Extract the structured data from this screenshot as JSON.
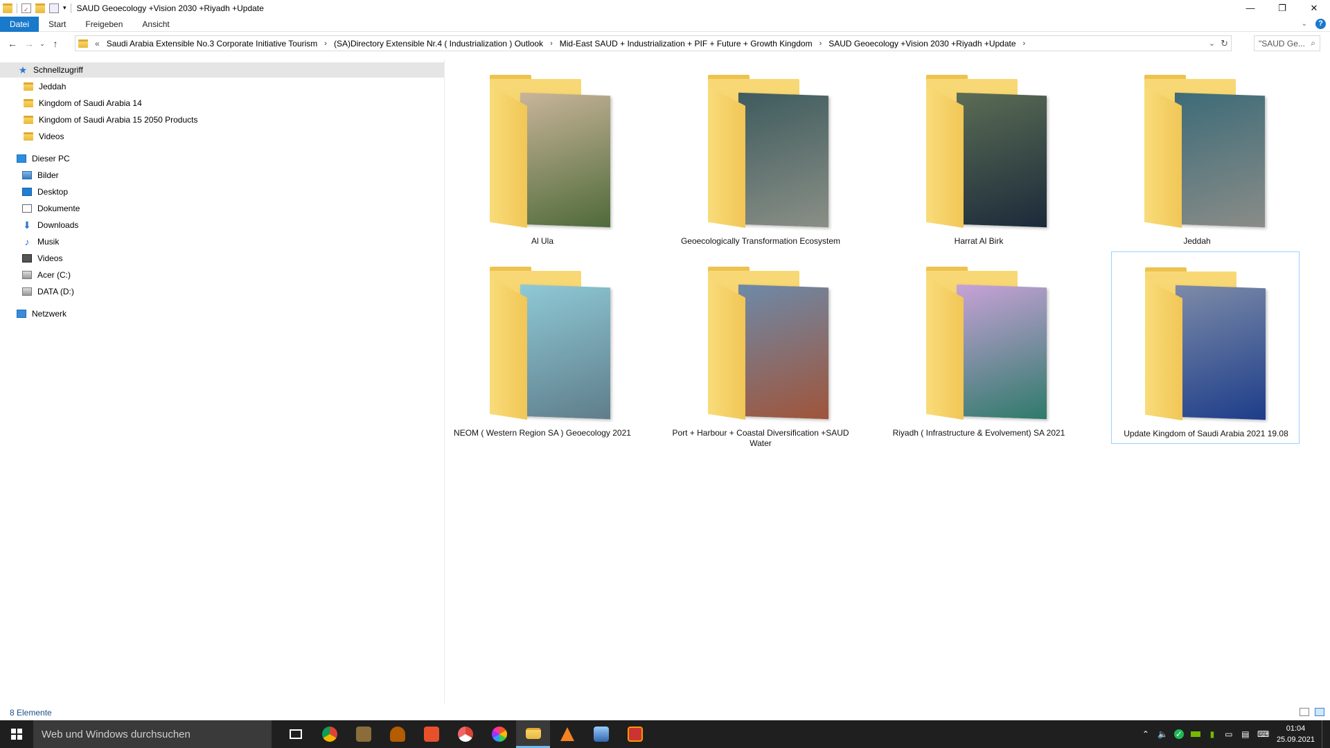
{
  "window": {
    "title": "SAUD Geoecology +Vision 2030 +Riyadh +Update",
    "min_glyph": "—",
    "max_glyph": "❐",
    "close_glyph": "✕"
  },
  "ribbon": {
    "tabs": [
      {
        "label": "Datei"
      },
      {
        "label": "Start"
      },
      {
        "label": "Freigeben"
      },
      {
        "label": "Ansicht"
      }
    ],
    "help": "?"
  },
  "address": {
    "overflow": "«",
    "crumbs": [
      "Saudi Arabia Extensible No.3 Corporate Initiative Tourism",
      "(SA)Directory Extensible Nr.4 ( Industrialization ) Outlook",
      "Mid-East SAUD + Industrialization + PIF + Future + Growth Kingdom",
      "SAUD Geoecology +Vision 2030 +Riyadh +Update"
    ],
    "separator": "›",
    "search_placeholder": "\"SAUD Ge..."
  },
  "navpane": {
    "quick_access": "Schnellzugriff",
    "quick_items": [
      {
        "label": "Jeddah"
      },
      {
        "label": "Kingdom of Saudi Arabia 14"
      },
      {
        "label": "Kingdom of Saudi Arabia 15 2050 Products"
      },
      {
        "label": "Videos"
      }
    ],
    "this_pc": "Dieser PC",
    "pc_items": [
      {
        "label": "Bilder",
        "icon": "pictures-icon"
      },
      {
        "label": "Desktop",
        "icon": "desktop-icon"
      },
      {
        "label": "Dokumente",
        "icon": "documents-icon"
      },
      {
        "label": "Downloads",
        "icon": "downloads-icon"
      },
      {
        "label": "Musik",
        "icon": "music-icon"
      },
      {
        "label": "Videos",
        "icon": "videos-icon"
      },
      {
        "label": "Acer (C:)",
        "icon": "drive-icon"
      },
      {
        "label": "DATA (D:)",
        "icon": "drive-icon"
      }
    ],
    "network": "Netzwerk"
  },
  "folders": [
    {
      "name": "Al Ula",
      "color1": "#c9b59a",
      "color2": "#4f6a3a"
    },
    {
      "name": "Geoecologically Transformation Ecosystem",
      "color1": "#3e5b5e",
      "color2": "#8a8f86"
    },
    {
      "name": "Harrat Al Birk",
      "color1": "#5b6d55",
      "color2": "#1b2a3a"
    },
    {
      "name": "Jeddah",
      "color1": "#3d6b78",
      "color2": "#8a8c88"
    },
    {
      "name": "NEOM ( Western Region SA ) Geoecology 2021",
      "color1": "#8fc9d6",
      "color2": "#5f7d8a"
    },
    {
      "name": "Port + Harbour + Coastal Diversification +SAUD Water",
      "color1": "#6d8aa8",
      "color2": "#a0543a"
    },
    {
      "name": "Riyadh ( Infrastructure & Evolvement) SA 2021",
      "color1": "#c8a2d8",
      "color2": "#2e7a6a"
    },
    {
      "name": "Update Kingdom of Saudi Arabia 2021 19.08",
      "color1": "#7d8ba8",
      "color2": "#1d3d8a"
    }
  ],
  "status": {
    "count": "8 Elemente"
  },
  "taskbar": {
    "search_placeholder": "Web und Windows durchsuchen",
    "time": "01:04",
    "date": "25.09.2021"
  }
}
